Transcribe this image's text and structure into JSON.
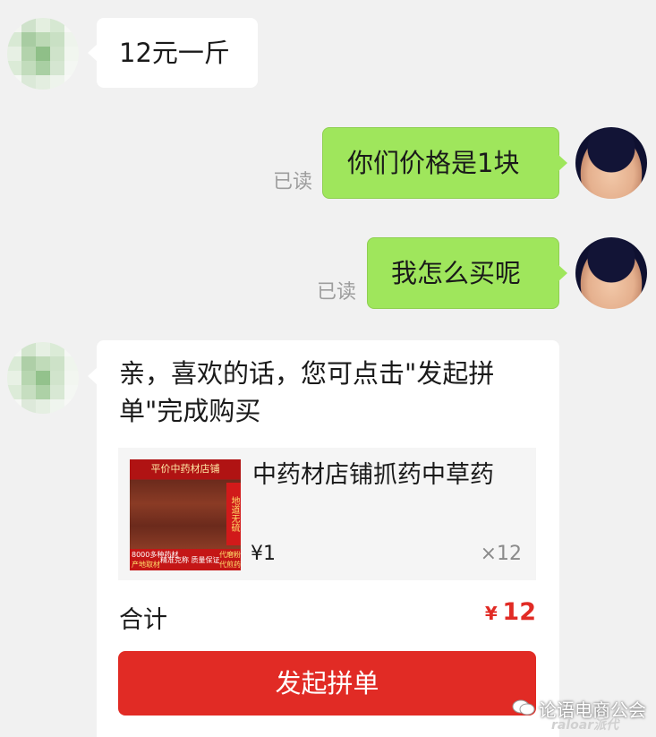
{
  "messages": [
    {
      "text": "12元一斤"
    },
    {
      "text": "你们价格是1块",
      "read_label": "已读"
    },
    {
      "text": "我怎么买呢",
      "read_label": "已读"
    },
    {
      "text": "亲，喜欢的话，您可点击\"发起拼单\"完成购买"
    }
  ],
  "product": {
    "title": "中药材店铺抓药中草药",
    "price": "¥1",
    "quantity": "×12",
    "thumb_title": "平价中药材店铺",
    "thumb_side": "地道无硫",
    "thumb_band_1": "8000多种药材",
    "thumb_band_2": "精准克称 质量保证",
    "thumb_band_3": "代磨粉",
    "thumb_band_4": "产地取材",
    "thumb_band_5": "代煎药"
  },
  "total": {
    "label": "合计",
    "currency": "¥",
    "amount": "12"
  },
  "action": {
    "button_label": "发起拼单"
  },
  "watermark": {
    "text": "论语电商公会",
    "sub": "raloar派代"
  },
  "colors": {
    "accent": "#e12b25",
    "sent_bubble": "#9fe65c",
    "background": "#f1f1f1"
  }
}
